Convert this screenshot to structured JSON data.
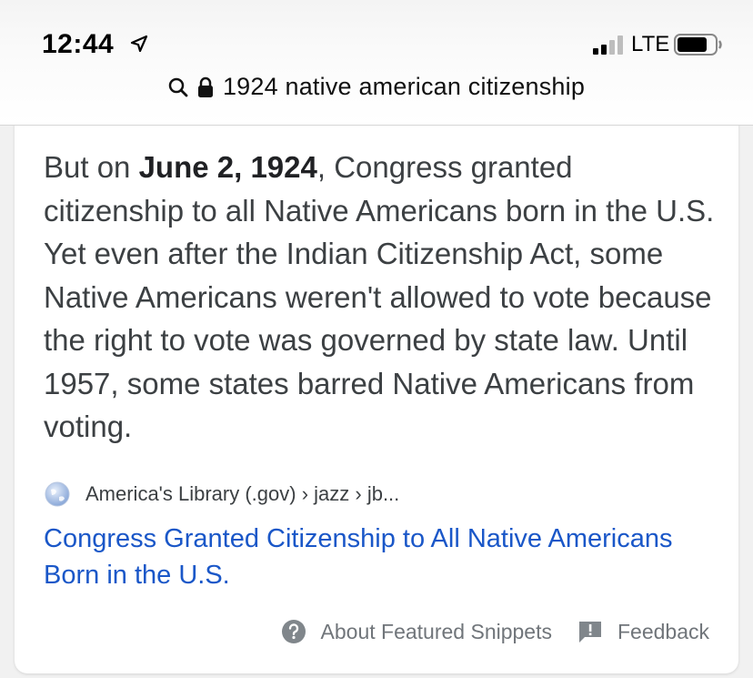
{
  "status_bar": {
    "time": "12:44",
    "network": "LTE"
  },
  "address_bar": {
    "query": "1924 native american citizenship"
  },
  "snippet": {
    "prefix": "But on ",
    "highlight": "June 2, 1924",
    "suffix": ", Congress granted citizenship to all Native Americans born in the U.S. Yet even after the Indian Citizenship Act, some Native Americans weren't allowed to vote because the right to vote was governed by state law. Until 1957, some states barred Native Americans from voting."
  },
  "source": {
    "breadcrumb": "America's Library (.gov) › jazz › jb..."
  },
  "result": {
    "title": "Congress Granted Citizenship to All Native Americans Born in the U.S."
  },
  "footer": {
    "about_label": "About Featured Snippets",
    "feedback_label": "Feedback"
  },
  "icons": {
    "location": "location-arrow-icon",
    "signal": "cellular-signal-icon",
    "battery": "battery-icon",
    "search": "search-icon",
    "lock": "lock-icon",
    "globe": "globe-icon",
    "help": "help-icon",
    "feedback": "feedback-icon"
  },
  "colors": {
    "link": "#1a57c8",
    "text": "#3c4043",
    "muted": "#70757a"
  }
}
